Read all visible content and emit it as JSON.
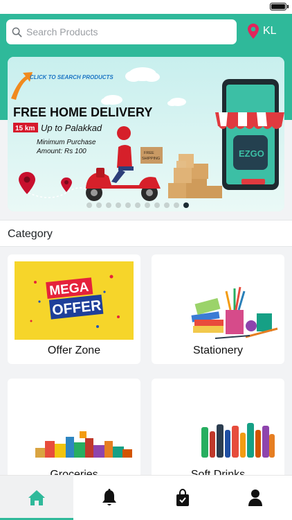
{
  "search": {
    "placeholder": "Search Products",
    "icon": "search-icon"
  },
  "location": {
    "label": "KL",
    "icon": "location-pin-icon"
  },
  "banner": {
    "click_text": "CLICK TO SEARCH PRODUCTS",
    "headline": "FREE HOME DELIVERY",
    "distance_badge": "15 km",
    "distance_text": "Up to Palakkad",
    "min_purchase_line1": "Minimum Purchase",
    "min_purchase_line2": "Amount: Rs 100",
    "box_label_1": "FREE",
    "box_label_2": "SHIPPING",
    "app_logo": "EZGO",
    "slides_total": 11,
    "active_slide": 11
  },
  "category": {
    "title": "Category",
    "items": [
      {
        "label": "Offer Zone",
        "image_text_1": "MEGA",
        "image_text_2": "OFFER"
      },
      {
        "label": "Stationery"
      },
      {
        "label": "Groceries"
      },
      {
        "label": "Soft Drinks"
      }
    ]
  },
  "nav": {
    "items": [
      {
        "icon": "home-icon",
        "active": true
      },
      {
        "icon": "bell-icon",
        "active": false
      },
      {
        "icon": "shopping-bag-icon",
        "active": false
      },
      {
        "icon": "user-icon",
        "active": false
      }
    ]
  },
  "colors": {
    "primary": "#2fb99a",
    "active_nav_icon": "#2fb99a"
  }
}
